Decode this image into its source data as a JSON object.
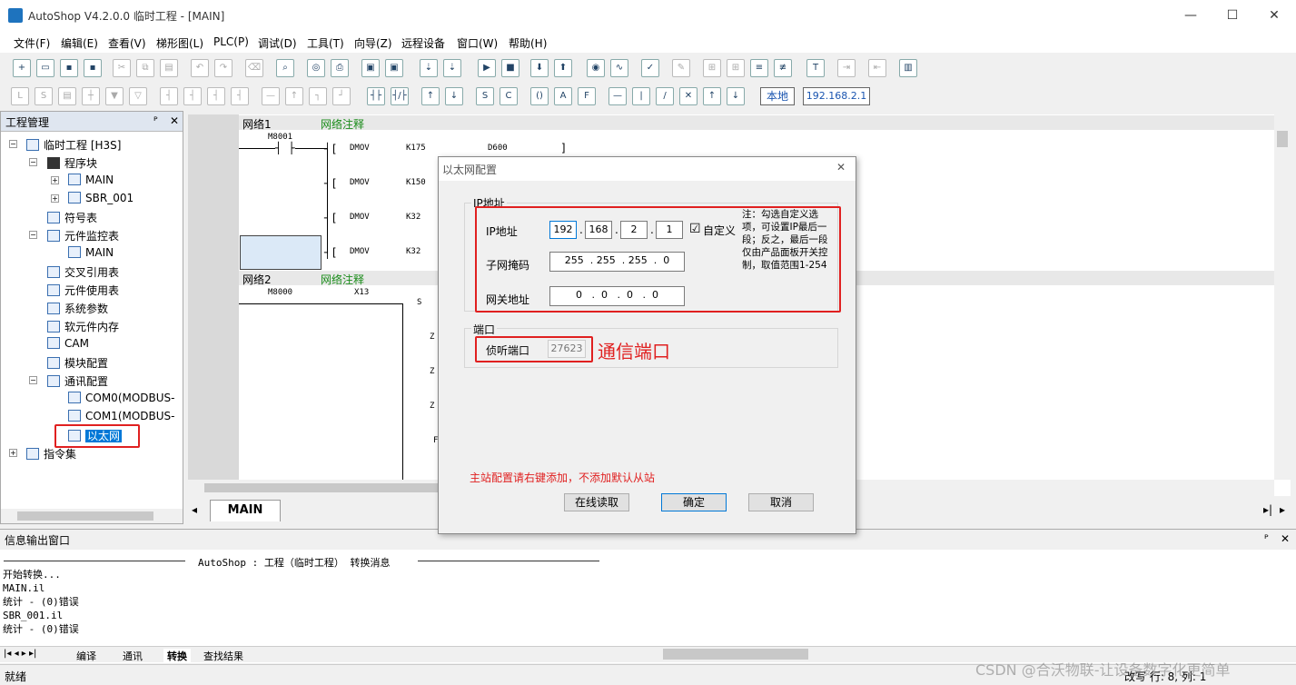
{
  "window": {
    "title": "AutoShop V4.2.0.0  临时工程 - [MAIN]",
    "min": "—",
    "max": "☐",
    "close": "✕"
  },
  "menu": [
    "文件(F)",
    "编辑(E)",
    "查看(V)",
    "梯形图(L)",
    "PLC(P)",
    "调试(D)",
    "工具(T)",
    "向导(Z)",
    "远程设备",
    "窗口(W)",
    "帮助(H)"
  ],
  "toolbar2": {
    "local": "本地",
    "ip": "192.168.2.1"
  },
  "project": {
    "title": "工程管理",
    "pin": "ᴾ",
    "close": "✕",
    "root": "临时工程 [H3S]",
    "program_block": "程序块",
    "main": "MAIN",
    "sbr": "SBR_001",
    "symbols": "符号表",
    "monitor": "元件监控表",
    "monitor_main": "MAIN",
    "xref": "交叉引用表",
    "usage": "元件使用表",
    "sysparam": "系统参数",
    "softmem": "软元件内存",
    "cam": "CAM",
    "module": "模块配置",
    "comm": "通讯配置",
    "com0": "COM0(MODBUS-",
    "com1": "COM1(MODBUS-",
    "ethernet": "以太网",
    "instr": "指令集"
  },
  "ladder": {
    "net1": "网络1",
    "net1_comment": "网络注释",
    "m8001": "M8001",
    "r1": [
      "DMOV",
      "K175",
      "D600",
      "]"
    ],
    "r2": [
      "DMOV",
      "K150"
    ],
    "r3": [
      "DMOV",
      "K32"
    ],
    "r4": [
      "DMOV",
      "K32"
    ],
    "net2": "网络2",
    "net2_comment": "网络注释",
    "m8000": "M8000",
    "x13": "X13",
    "s": "S",
    "z1": "Z",
    "z2": "Z",
    "z3": "Z",
    "f": "F"
  },
  "tabs": {
    "main": "MAIN",
    "left": "◂",
    "right": "▸",
    "right2": "▸|"
  },
  "dialog": {
    "title": "以太网配置",
    "close": "✕",
    "ip_group": "IP地址",
    "ip_label": "IP地址",
    "ip": [
      "192",
      "168",
      "2",
      "1"
    ],
    "custom": "自定义",
    "checkbox": "☑",
    "note": "注：勾选自定义选项，可设置IP最后一段；反之，最后一段仅由产品面板开关控制，取值范围1-254",
    "mask_label": "子网掩码",
    "mask": "255  . 255  . 255  .  0",
    "gw_label": "网关地址",
    "gw": "0   .  0   .  0   .  0",
    "port_group": "端口",
    "port_label": "侦听端口",
    "port": "27623",
    "annotation": "通信端口",
    "hint": "主站配置请右键添加，不添加默认从站",
    "btn_read": "在线读取",
    "btn_ok": "确定",
    "btn_cancel": "取消"
  },
  "output": {
    "title": "信息输出窗口",
    "header": "AutoShop : 工程（临时工程） 转换消息",
    "lines": "开始转换...\nMAIN.il\n统计 - (0)错误\nSBR_001.il\n统计 - (0)错误",
    "tabs": [
      "编译",
      "通讯",
      "转换",
      "查找结果"
    ]
  },
  "status": {
    "left": "就绪",
    "fields": "改写  行:  8, 列:  1"
  },
  "watermark": "CSDN @合沃物联-让设备数字化更简单"
}
